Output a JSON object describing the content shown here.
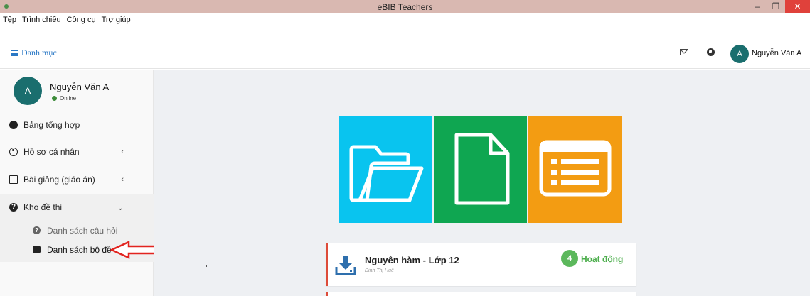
{
  "window": {
    "title": "eBIB Teachers",
    "minimize": "–",
    "maximize": "❐",
    "close": "✕"
  },
  "menubar": [
    "Tệp",
    "Trình chiếu",
    "Công cụ",
    "Trợ giúp"
  ],
  "header": {
    "menu_label": "Danh mục",
    "avatar_letter": "A",
    "user_name": "Nguyễn Văn A",
    "icons": [
      "mail-icon",
      "globe-icon"
    ]
  },
  "sidebar": {
    "profile": {
      "avatar_letter": "A",
      "name": "Nguyễn Văn A",
      "status": "Online"
    },
    "items": [
      {
        "label": "Bảng tổng hợp",
        "icon": "dashboard-icon"
      },
      {
        "label": "Hồ sơ cá nhân",
        "icon": "user-circle-icon",
        "chevron": "‹"
      },
      {
        "label": "Bài giảng (giáo án)",
        "icon": "newspaper-icon",
        "chevron": "‹"
      },
      {
        "label": "Kho đề thi",
        "icon": "question-icon",
        "chevron": "⌄"
      }
    ],
    "subitems": [
      {
        "label": "Danh sách câu hỏi",
        "icon": "question-icon"
      },
      {
        "label": "Danh sách bộ đề",
        "icon": "database-icon"
      }
    ]
  },
  "tiles": [
    {
      "icon": "folder-open-icon",
      "color": "#09c4ef"
    },
    {
      "icon": "file-icon",
      "color": "#0fa651"
    },
    {
      "icon": "list-icon",
      "color": "#f39c12"
    }
  ],
  "cards": [
    {
      "title": "Nguyên hàm - Lớp 12",
      "author": "Đinh Thị Huế",
      "count": "4",
      "status": "Hoạt động",
      "icon": "download-icon"
    }
  ],
  "colors": {
    "accent": "#2a78c5",
    "avatar": "#1a6e6e",
    "card_border": "#dd4b39",
    "status_green": "#5cb85c"
  }
}
